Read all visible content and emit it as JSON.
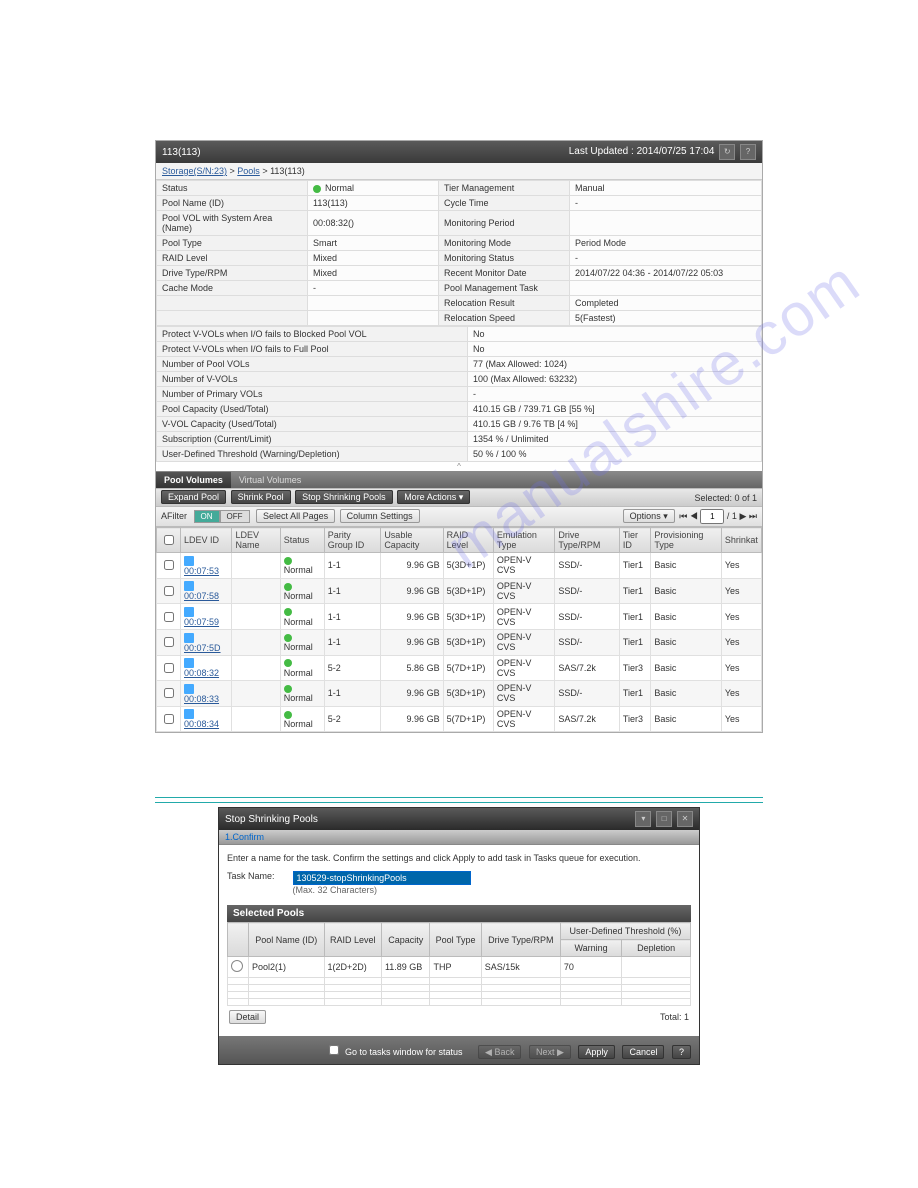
{
  "header": {
    "title": "113(113)",
    "updated": "Last Updated : 2014/07/25 17:04"
  },
  "breadcrumb": {
    "a": "Storage(S/N:23)",
    "b": "Pools",
    "c": "113(113)"
  },
  "props": [
    {
      "l": "Status",
      "v": "Normal",
      "l2": "Tier Management",
      "v2": "Manual"
    },
    {
      "l": "Pool Name (ID)",
      "v": "113(113)",
      "l2": "Cycle Time",
      "v2": "-"
    },
    {
      "l": "Pool VOL with System Area (Name)",
      "v": "00:08:32()",
      "l2": "Monitoring Period",
      "v2": ""
    },
    {
      "l": "Pool Type",
      "v": "Smart",
      "l2": "Monitoring Mode",
      "v2": "Period Mode"
    },
    {
      "l": "RAID Level",
      "v": "Mixed",
      "l2": "Monitoring Status",
      "v2": "-"
    },
    {
      "l": "Drive Type/RPM",
      "v": "Mixed",
      "l2": "Recent Monitor Date",
      "v2": "2014/07/22 04:36 - 2014/07/22 05:03"
    },
    {
      "l": "Cache Mode",
      "v": "-",
      "l2": "Pool Management Task",
      "v2": ""
    },
    {
      "l": "",
      "v": "",
      "l2": "Relocation Result",
      "v2": "Completed"
    },
    {
      "l": "",
      "v": "",
      "l2": "Relocation Speed",
      "v2": "5(Fastest)"
    }
  ],
  "props2": [
    {
      "l": "Protect V-VOLs when I/O fails to Blocked Pool VOL",
      "v": "No"
    },
    {
      "l": "Protect V-VOLs when I/O fails to Full Pool",
      "v": "No"
    },
    {
      "l": "Number of Pool VOLs",
      "v": "77 (Max Allowed: 1024)"
    },
    {
      "l": "Number of V-VOLs",
      "v": "100 (Max Allowed: 63232)"
    },
    {
      "l": "Number of Primary VOLs",
      "v": "-"
    },
    {
      "l": "Pool Capacity (Used/Total)",
      "v": "410.15 GB / 739.71 GB [55 %]"
    },
    {
      "l": "V-VOL Capacity (Used/Total)",
      "v": "410.15 GB / 9.76 TB [4 %]"
    },
    {
      "l": "Subscription (Current/Limit)",
      "v": "1354 % / Unlimited"
    },
    {
      "l": "User-Defined Threshold (Warning/Depletion)",
      "v": "50 % / 100 %"
    }
  ],
  "tabs": {
    "a": "Pool Volumes",
    "b": "Virtual Volumes"
  },
  "toolbar": {
    "expand": "Expand Pool",
    "shrink": "Shrink Pool",
    "stop": "Stop Shrinking Pools",
    "more": "More Actions",
    "sel": "Selected:  0   of  1"
  },
  "filter": {
    "label": "AFilter",
    "on": "ON",
    "off": "OFF",
    "selall": "Select All Pages",
    "cols": "Column Settings",
    "opts": "Options ▾",
    "page": "1",
    "of": "/ 1"
  },
  "cols": {
    "c1": "LDEV ID",
    "c2": "LDEV Name",
    "c3": "Status",
    "c4": "Parity Group ID",
    "c5": "Usable Capacity",
    "c6": "RAID Level",
    "c7": "Emulation Type",
    "c8": "Drive Type/RPM",
    "c9": "Tier ID",
    "c10": "Provisioning Type",
    "c11": "Shrinkat"
  },
  "rows": [
    {
      "id": "00:07:53",
      "st": "Normal",
      "pg": "1-1",
      "cap": "9.96 GB",
      "raid": "5(3D+1P)",
      "em": "OPEN-V CVS",
      "drv": "SSD/-",
      "tier": "Tier1",
      "prov": "Basic",
      "sh": "Yes"
    },
    {
      "id": "00:07:58",
      "st": "Normal",
      "pg": "1-1",
      "cap": "9.96 GB",
      "raid": "5(3D+1P)",
      "em": "OPEN-V CVS",
      "drv": "SSD/-",
      "tier": "Tier1",
      "prov": "Basic",
      "sh": "Yes"
    },
    {
      "id": "00:07:59",
      "st": "Normal",
      "pg": "1-1",
      "cap": "9.96 GB",
      "raid": "5(3D+1P)",
      "em": "OPEN-V CVS",
      "drv": "SSD/-",
      "tier": "Tier1",
      "prov": "Basic",
      "sh": "Yes"
    },
    {
      "id": "00:07:5D",
      "st": "Normal",
      "pg": "1-1",
      "cap": "9.96 GB",
      "raid": "5(3D+1P)",
      "em": "OPEN-V CVS",
      "drv": "SSD/-",
      "tier": "Tier1",
      "prov": "Basic",
      "sh": "Yes"
    },
    {
      "id": "00:08:32",
      "st": "Normal",
      "pg": "5-2",
      "cap": "5.86 GB",
      "raid": "5(7D+1P)",
      "em": "OPEN-V CVS",
      "drv": "SAS/7.2k",
      "tier": "Tier3",
      "prov": "Basic",
      "sh": "Yes"
    },
    {
      "id": "00:08:33",
      "st": "Normal",
      "pg": "1-1",
      "cap": "9.96 GB",
      "raid": "5(3D+1P)",
      "em": "OPEN-V CVS",
      "drv": "SSD/-",
      "tier": "Tier1",
      "prov": "Basic",
      "sh": "Yes"
    },
    {
      "id": "00:08:34",
      "st": "Normal",
      "pg": "5-2",
      "cap": "9.96 GB",
      "raid": "5(7D+1P)",
      "em": "OPEN-V CVS",
      "drv": "SAS/7.2k",
      "tier": "Tier3",
      "prov": "Basic",
      "sh": "Yes"
    }
  ],
  "dlg": {
    "title": "Stop Shrinking Pools",
    "step": "1.Confirm",
    "msg": "Enter a name for the task. Confirm the settings and click Apply to add task in Tasks queue for execution.",
    "tnlabel": "Task Name:",
    "tn": "130529-stopShrinkingPools",
    "hint": "(Max. 32 Characters)",
    "sub": "Selected Pools",
    "cols": {
      "c1": "Pool Name (ID)",
      "c2": "RAID Level",
      "c3": "Capacity",
      "c4": "Pool Type",
      "c5": "Drive Type/RPM",
      "c6": "User-Defined Threshold (%)",
      "c6a": "Warning",
      "c6b": "Depletion"
    },
    "row": {
      "name": "Pool2(1)",
      "raid": "1(2D+2D)",
      "cap": "11.89 GB",
      "type": "THP",
      "drv": "SAS/15k",
      "warn": "70",
      "dep": ""
    },
    "detail": "Detail",
    "total": "Total:  1",
    "goto": "Go to tasks window for status",
    "back": "◀ Back",
    "next": "Next ▶",
    "apply": "Apply",
    "cancel": "Cancel"
  }
}
